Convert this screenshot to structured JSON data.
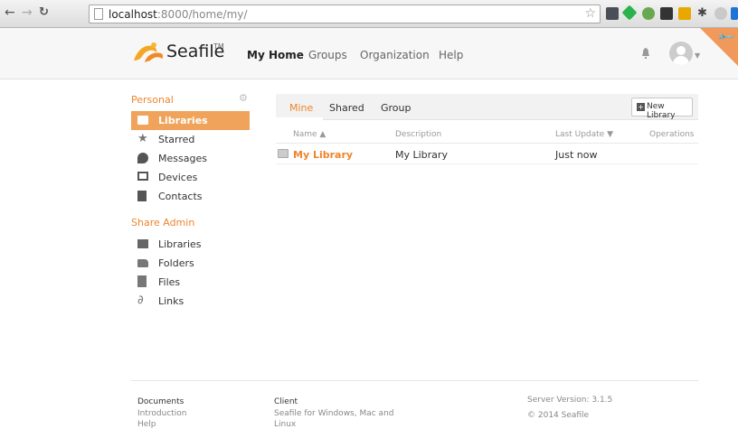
{
  "browser": {
    "url_host": "localhost",
    "url_path": ":8000/home/my/"
  },
  "header": {
    "logo_text": "Seafile",
    "logo_tm": "TM",
    "nav": [
      {
        "label": "My Home"
      },
      {
        "label": "Groups"
      },
      {
        "label": "Organization"
      },
      {
        "label": "Help"
      }
    ]
  },
  "sidebar": {
    "personal_heading": "Personal",
    "personal_items": [
      {
        "label": "Libraries",
        "icon": "library-icon",
        "active": true
      },
      {
        "label": "Starred",
        "icon": "star-icon"
      },
      {
        "label": "Messages",
        "icon": "message-icon"
      },
      {
        "label": "Devices",
        "icon": "monitor-icon"
      },
      {
        "label": "Contacts",
        "icon": "contacts-icon"
      }
    ],
    "admin_heading": "Share Admin",
    "admin_items": [
      {
        "label": "Libraries",
        "icon": "library-icon"
      },
      {
        "label": "Folders",
        "icon": "folder-icon"
      },
      {
        "label": "Files",
        "icon": "file-icon"
      },
      {
        "label": "Links",
        "icon": "link-icon"
      }
    ]
  },
  "main": {
    "tabs": [
      {
        "label": "Mine",
        "active": true
      },
      {
        "label": "Shared"
      },
      {
        "label": "Group"
      }
    ],
    "new_library_label": "New Library",
    "columns": {
      "name": "Name ▲",
      "description": "Description",
      "last_update": "Last Update ▼",
      "operations": "Operations"
    },
    "rows": [
      {
        "name": "My Library",
        "description": "My Library",
        "last_update": "Just now"
      }
    ]
  },
  "footer": {
    "documents_heading": "Documents",
    "documents_links": [
      "Introduction",
      "Help"
    ],
    "client_heading": "Client",
    "client_text_1": "Seafile for Windows, Mac and",
    "client_text_2": "Linux",
    "server_version": "Server Version: 3.1.5",
    "copyright": "© 2014 Seafile"
  },
  "colors": {
    "accent": "#f0842c",
    "active_bg": "#f0a35a"
  }
}
